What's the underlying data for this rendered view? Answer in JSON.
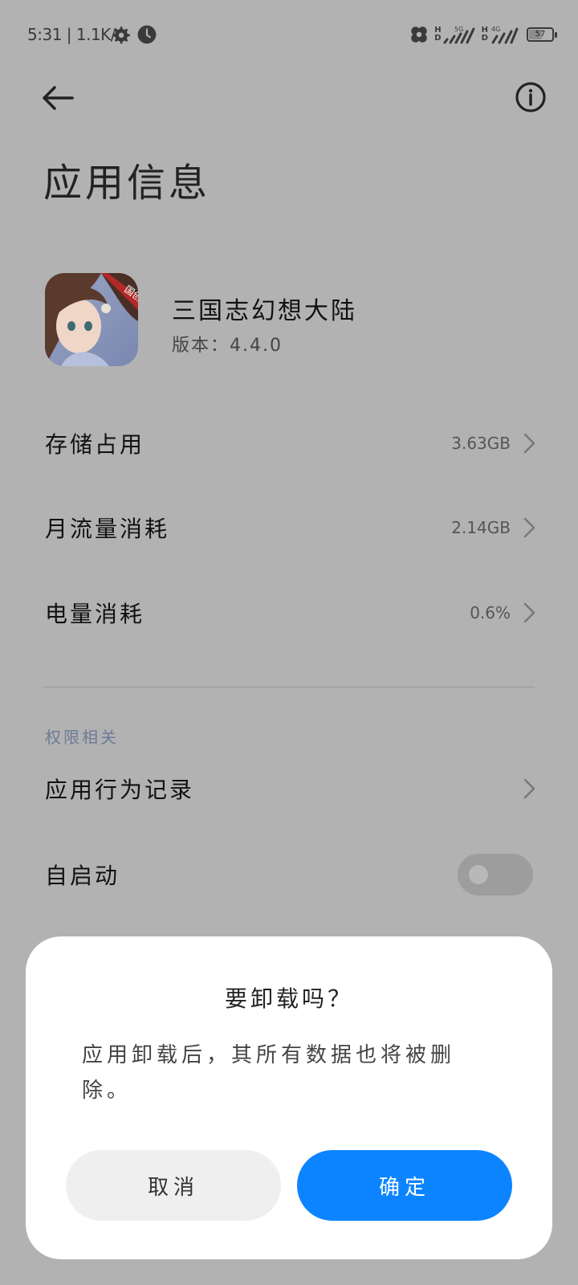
{
  "status_bar": {
    "time_speed": "5:31 | 1.1K/s",
    "network_labels": [
      "5G",
      "4G"
    ],
    "battery": "57",
    "battery_level": 0.57
  },
  "page": {
    "title": "应用信息"
  },
  "app": {
    "name": "三国志幻想大陆",
    "version": "版本：4.4.0",
    "icon_badge": "国创"
  },
  "usage": [
    {
      "label": "存储占用",
      "value": "3.63GB"
    },
    {
      "label": "月流量消耗",
      "value": "2.14GB"
    },
    {
      "label": "电量消耗",
      "value": "0.6%"
    }
  ],
  "permissions": {
    "section_title": "权限相关",
    "behavior_record": "应用行为记录",
    "autostart": {
      "label": "自启动",
      "enabled": false
    }
  },
  "dialog": {
    "title": "要卸载吗？",
    "message": "应用卸载后，其所有数据也将被删除。",
    "cancel": "取消",
    "confirm": "确定",
    "confirm_color": "#0d84ff"
  }
}
